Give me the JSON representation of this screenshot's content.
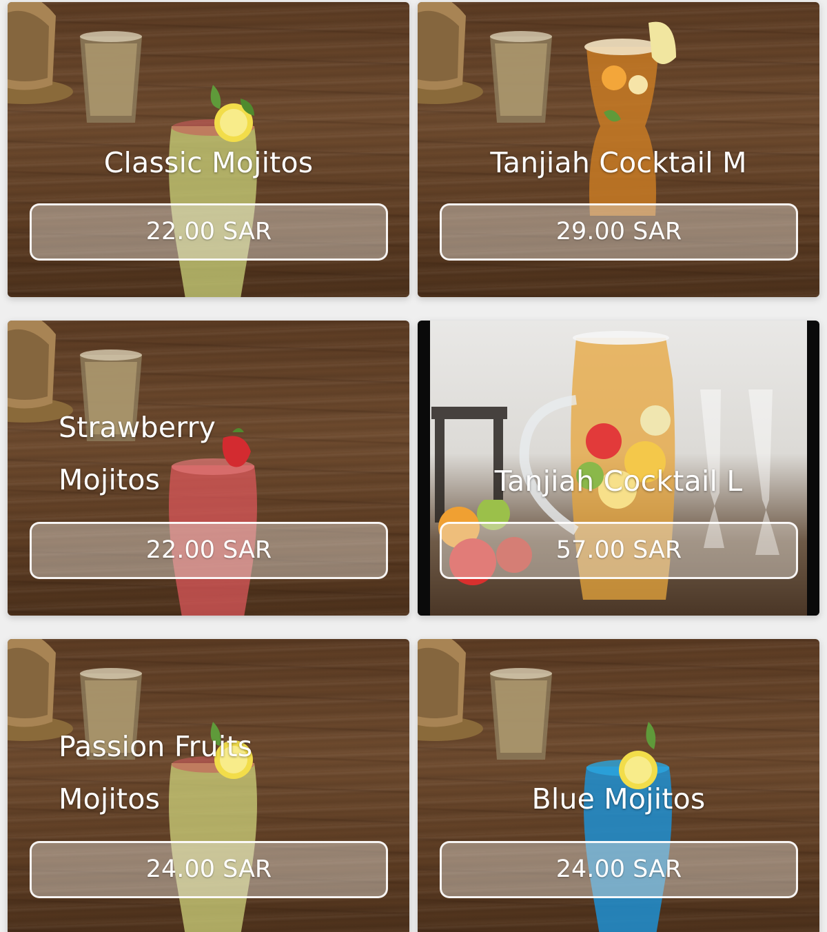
{
  "menu": {
    "items": [
      {
        "name": "Classic Mojitos",
        "price": "22.00 SAR",
        "drink_color": "#c9d27a"
      },
      {
        "name": "Tanjiah Cocktail M",
        "price": "29.00 SAR",
        "drink_color": "#c77a24"
      },
      {
        "name": "Strawberry Mojitos",
        "name_line1": "Strawberry",
        "name_line2": "Mojitos",
        "price": "22.00 SAR",
        "drink_color": "#d9575a"
      },
      {
        "name": "Tanjiah Cocktail L",
        "price": "57.00 SAR",
        "drink_color": "#e7a63c"
      },
      {
        "name": "Passion Fruits Mojitos",
        "name_line1": "Passion Fruits",
        "name_line2": "Mojitos",
        "price": "24.00 SAR",
        "drink_color": "#cdd27b"
      },
      {
        "name": "Blue Mojitos",
        "price": "24.00 SAR",
        "drink_color": "#1f8fd1"
      }
    ]
  },
  "icons": {
    "lantern": "lantern-decoration",
    "tea_glass": "tea-glass-decoration",
    "drink": "drink-glass-image"
  }
}
